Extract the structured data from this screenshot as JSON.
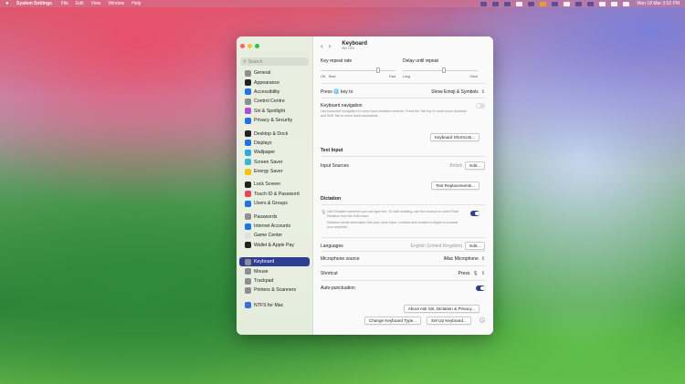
{
  "menubar": {
    "app": "System Settings",
    "items": [
      "File",
      "Edit",
      "View",
      "Window",
      "Help"
    ],
    "clock": "Mon 18 Mar  3:52 PM"
  },
  "window": {
    "title": "Keyboard",
    "subtitle": "MB 13%",
    "search_placeholder": "Search"
  },
  "sidebar": {
    "items": [
      {
        "label": "General",
        "color": "#8e8e93",
        "icon": "gear-icon"
      },
      {
        "label": "Appearance",
        "color": "#222222",
        "icon": "appearance-icon"
      },
      {
        "label": "Accessibility",
        "color": "#1e73e8",
        "icon": "accessibility-icon"
      },
      {
        "label": "Control Centre",
        "color": "#8e8e93",
        "icon": "control-centre-icon"
      },
      {
        "label": "Siri & Spotlight",
        "color": "#b44ad9",
        "icon": "siri-icon"
      },
      {
        "label": "Privacy & Security",
        "color": "#1e73e8",
        "icon": "privacy-hand-icon"
      },
      {
        "label": "Desktop & Dock",
        "color": "#222222",
        "icon": "dock-icon"
      },
      {
        "label": "Displays",
        "color": "#1e73e8",
        "icon": "display-icon"
      },
      {
        "label": "Wallpaper",
        "color": "#2aa8e0",
        "icon": "wallpaper-icon"
      },
      {
        "label": "Screen Saver",
        "color": "#35b8d8",
        "icon": "screen-saver-icon"
      },
      {
        "label": "Energy Saver",
        "color": "#f5c400",
        "icon": "battery-icon"
      },
      {
        "label": "Lock Screen",
        "color": "#222222",
        "icon": "lock-icon"
      },
      {
        "label": "Touch ID & Password",
        "color": "#e8445a",
        "icon": "fingerprint-icon"
      },
      {
        "label": "Users & Groups",
        "color": "#1e73e8",
        "icon": "users-icon"
      },
      {
        "label": "Passwords",
        "color": "#8e8e93",
        "icon": "key-icon"
      },
      {
        "label": "Internet Accounts",
        "color": "#1e73e8",
        "icon": "at-icon"
      },
      {
        "label": "Game Center",
        "color": "#e0e0e0",
        "icon": "game-center-icon"
      },
      {
        "label": "Wallet & Apple Pay",
        "color": "#222222",
        "icon": "wallet-icon"
      },
      {
        "label": "Keyboard",
        "color": "#8e8e93",
        "icon": "keyboard-icon"
      },
      {
        "label": "Mouse",
        "color": "#8e8e93",
        "icon": "mouse-icon"
      },
      {
        "label": "Trackpad",
        "color": "#8e8e93",
        "icon": "trackpad-icon"
      },
      {
        "label": "Printers & Scanners",
        "color": "#8e8e93",
        "icon": "printer-icon"
      },
      {
        "label": "NTFS for Mac",
        "color": "#3a6fd8",
        "icon": "ntfs-icon"
      }
    ]
  },
  "keyboard": {
    "key_repeat_label": "Key repeat rate",
    "key_repeat_left": "Off",
    "key_repeat_slow": "Slow",
    "key_repeat_fast": "Fast",
    "delay_label": "Delay until repeat",
    "delay_long": "Long",
    "delay_short": "Short",
    "press_key_prefix": "Press",
    "press_key_suffix": "key to",
    "press_key_value": "Show Emoji & Symbols",
    "nav_label": "Keyboard navigation",
    "nav_desc": "Use keyboard navigation to move focus between controls. Press the Tab key to move focus forwards and Shift Tab to move focus backwards.",
    "shortcuts_btn": "Keyboard Shortcuts...",
    "text_input_head": "Text Input",
    "input_sources_label": "Input Sources",
    "input_sources_value": "British",
    "edit_btn": "Edit...",
    "text_repl_btn": "Text Replacements...",
    "dictation_head": "Dictation",
    "dictation_desc1": "Use Dictation wherever you can type text. To start dictating, use the shortcut or select Start Dictation from the Edit menu.",
    "dictation_desc2": "Dictation sends information like your voice input, contacts and location to Apple to process your requests.",
    "languages_label": "Languages",
    "languages_value": "English (United Kingdom)",
    "mic_label": "Microphone source",
    "mic_value": "iMac Microphone",
    "shortcut_label": "Shortcut",
    "shortcut_value": "Press",
    "autopunct_label": "Auto-punctuation",
    "about_btn": "About Ask Siri, Dictation & Privacy...",
    "change_type_btn": "Change Keyboard Type...",
    "setup_btn": "Set Up Keyboard...",
    "help": "?"
  },
  "state": {
    "key_repeat_level": 0.77,
    "delay_level": 0.55,
    "keyboard_navigation_on": false,
    "dictation_on": true,
    "autopunctuation_on": true,
    "selected_sidebar": "Keyboard"
  },
  "colors": {
    "accent": "#2d3f8f"
  }
}
